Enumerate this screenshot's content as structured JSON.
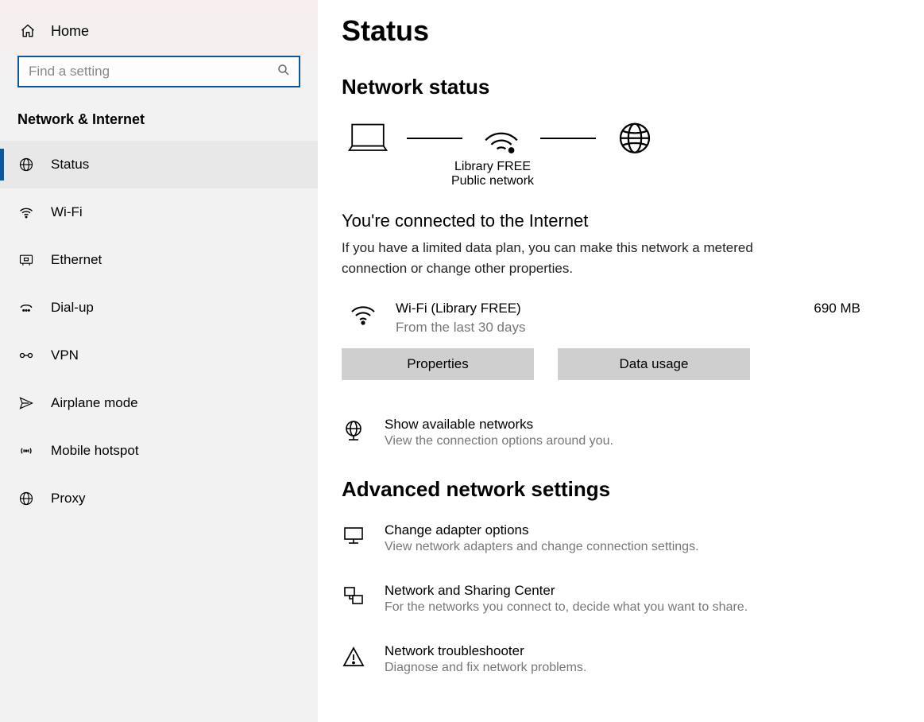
{
  "sidebar": {
    "home": "Home",
    "search_placeholder": "Find a setting",
    "category": "Network & Internet",
    "items": [
      {
        "label": "Status"
      },
      {
        "label": "Wi-Fi"
      },
      {
        "label": "Ethernet"
      },
      {
        "label": "Dial-up"
      },
      {
        "label": "VPN"
      },
      {
        "label": "Airplane mode"
      },
      {
        "label": "Mobile hotspot"
      },
      {
        "label": "Proxy"
      }
    ]
  },
  "main": {
    "title": "Status",
    "section1": "Network status",
    "diagram": {
      "ssid": "Library FREE",
      "type": "Public network"
    },
    "connected": {
      "title": "You're connected to the Internet",
      "desc": "If you have a limited data plan, you can make this network a metered connection or change other properties."
    },
    "wifi": {
      "name": "Wi-Fi (Library FREE)",
      "sub": "From the last 30 days",
      "usage": "690 MB"
    },
    "buttons": {
      "properties": "Properties",
      "data_usage": "Data usage"
    },
    "available": {
      "title": "Show available networks",
      "desc": "View the connection options around you."
    },
    "section2": "Advanced network settings",
    "adapter": {
      "title": "Change adapter options",
      "desc": "View network adapters and change connection settings."
    },
    "sharing": {
      "title": "Network and Sharing Center",
      "desc": "For the networks you connect to, decide what you want to share."
    },
    "trouble": {
      "title": "Network troubleshooter",
      "desc": "Diagnose and fix network problems."
    }
  }
}
